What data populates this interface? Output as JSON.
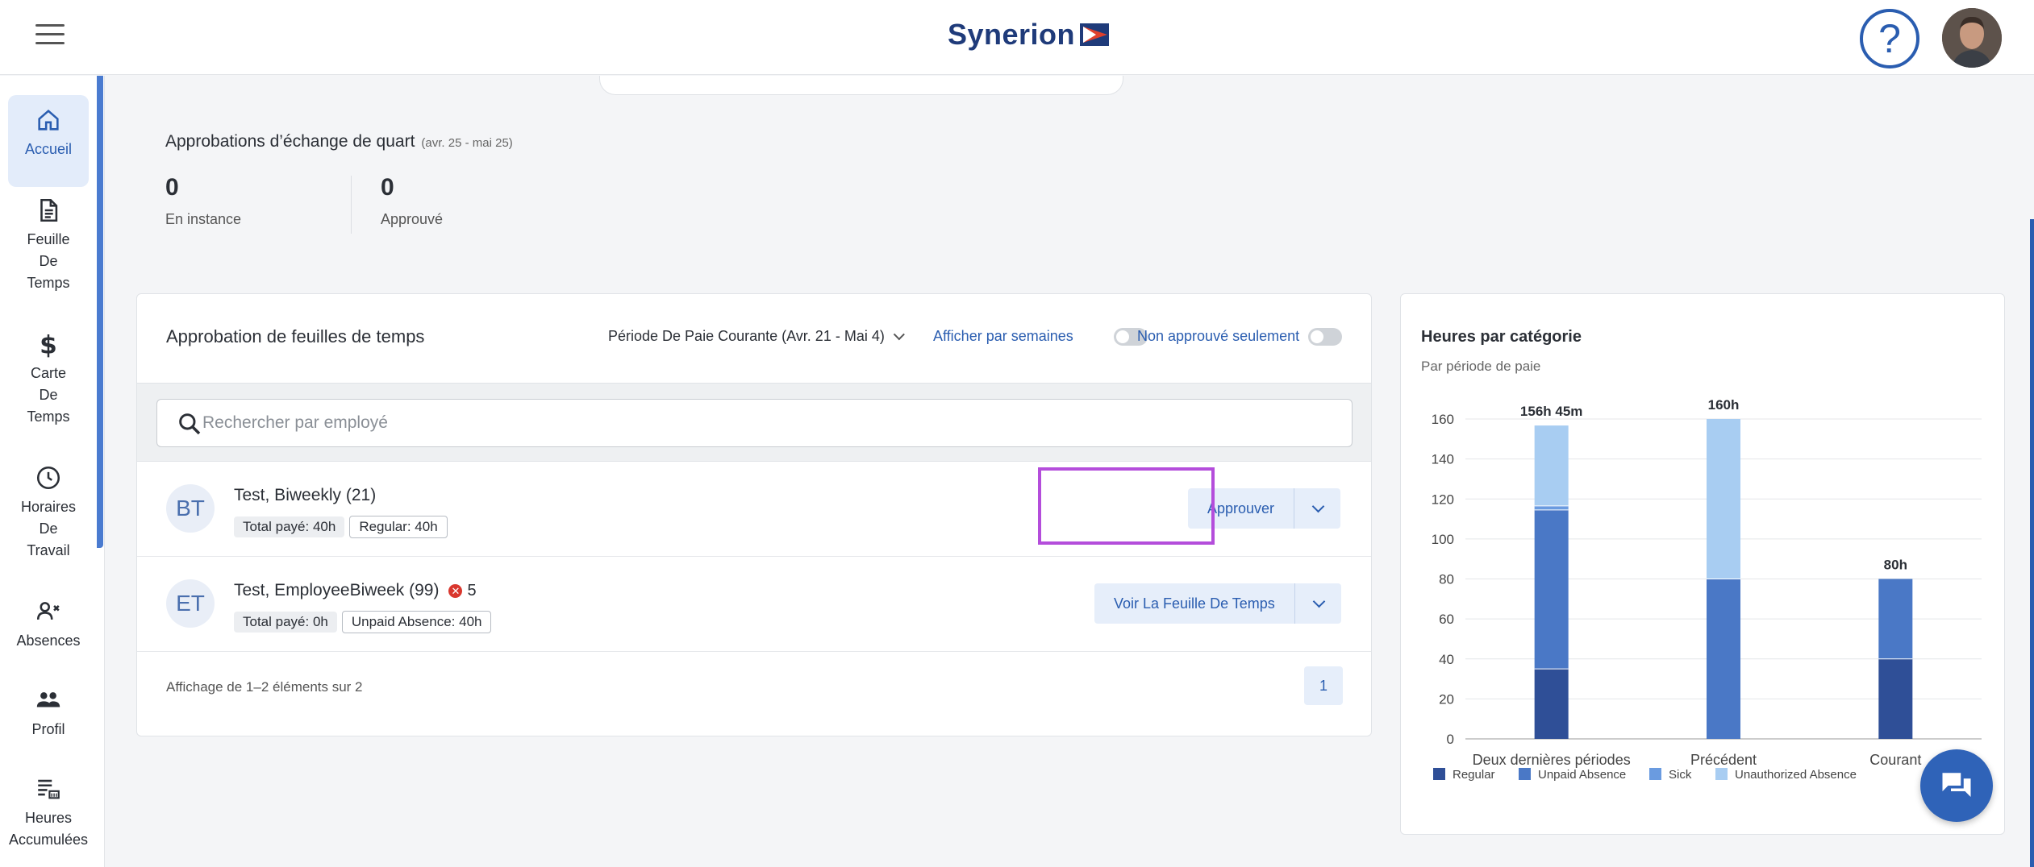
{
  "app": {
    "logo_text": "Synerion"
  },
  "sidebar": {
    "items": [
      {
        "label": "Accueil",
        "icon": "home-icon"
      },
      {
        "label": "Feuille De Temps",
        "icon": "document-icon"
      },
      {
        "label": "Carte De Temps",
        "icon": "dollar-icon"
      },
      {
        "label": "Horaires De Travail",
        "icon": "clock-icon"
      },
      {
        "label": "Absences",
        "icon": "person-x-icon"
      },
      {
        "label": "Profil",
        "icon": "people-icon"
      },
      {
        "label": "Heures Accumulées",
        "icon": "accrual-icon"
      }
    ]
  },
  "shift_approvals": {
    "title": "Approbations d’échange de quart",
    "range": "(avr. 25 - mai 25)",
    "pending_value": "0",
    "pending_label": "En instance",
    "approved_value": "0",
    "approved_label": "Approuvé"
  },
  "timesheet_approval": {
    "title": "Approbation de feuilles de temps",
    "period": "Période De Paie Courante (Avr. 21 - Mai 4)",
    "toggle_weeks_label": "Afficher par semaines",
    "toggle_unapproved_label": "Non approuvé seulement",
    "search_placeholder": "Rechercher par employé",
    "rows": [
      {
        "initials": "BT",
        "name": "Test, Biweekly (21)",
        "badge1": "Total payé: 40h",
        "badge2": "Regular: 40h",
        "action": "Approuver",
        "errors": ""
      },
      {
        "initials": "ET",
        "name": "Test, EmployeeBiweek (99)",
        "badge1": "Total payé: 0h",
        "badge2": "Unpaid Absence: 40h",
        "action": "Voir La Feuille De Temps",
        "errors": "5"
      }
    ],
    "paging_text": "Affichage de 1–2 éléments sur 2",
    "page": "1"
  },
  "chart_data": {
    "type": "bar",
    "stacked": true,
    "title": "Heures par catégorie",
    "subtitle": "Par période de paie",
    "categories": [
      "Deux dernières périodes",
      "Précédent",
      "Courant"
    ],
    "totals": [
      "156h 45m",
      "160h",
      "80h"
    ],
    "ylim": [
      0,
      160
    ],
    "yticks": [
      0,
      20,
      40,
      60,
      80,
      100,
      120,
      140,
      160
    ],
    "legend_position": "bottom",
    "series": [
      {
        "name": "Regular",
        "color": "#2f4f97",
        "values": [
          35,
          0,
          40
        ]
      },
      {
        "name": "Unpaid Absence",
        "color": "#4a78c6",
        "values": [
          79.5,
          80,
          40
        ]
      },
      {
        "name": "Sick",
        "color": "#6a9be0",
        "values": [
          2,
          0,
          0
        ]
      },
      {
        "name": "Unauthorized Absence",
        "color": "#a8cdf2",
        "values": [
          40.25,
          80,
          0
        ]
      }
    ]
  }
}
